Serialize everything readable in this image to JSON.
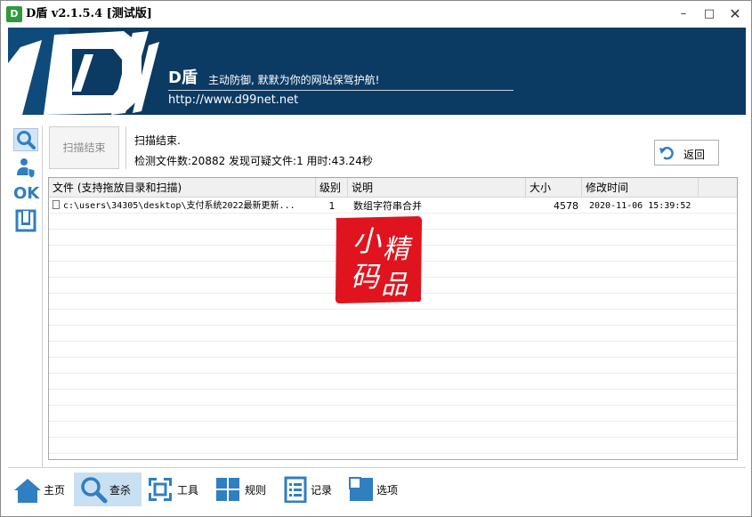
{
  "window": {
    "title": "D盾 v2.1.5.4 [测试版]",
    "icon_letter": "D",
    "controls": {
      "minimize": "–",
      "maximize": "□",
      "close": "✕"
    }
  },
  "banner": {
    "brand": "D盾",
    "slogan": "主动防御, 默默为你的网站保驾护航!",
    "url": "http://www.d99net.net",
    "background_color": "#0b3a63"
  },
  "sidebar": {
    "items": [
      {
        "name": "search",
        "icon": "search-icon",
        "active": true
      },
      {
        "name": "user-shield",
        "icon": "user-shield-icon",
        "active": false
      },
      {
        "name": "ok",
        "label": "OK",
        "active": false
      },
      {
        "name": "box",
        "icon": "box-icon",
        "active": false
      }
    ]
  },
  "scan": {
    "button_label": "扫描结束",
    "status": "扫描结束.",
    "summary": "检测文件数:20882 发现可疑文件:1 用时:43.24秒",
    "back_label": "返回"
  },
  "table": {
    "columns": [
      "文件 (支持拖放目录和扫描)",
      "级别",
      "说明",
      "大小",
      "修改时间"
    ],
    "rows": [
      {
        "file": "c:\\users\\34305\\desktop\\支付系统2022最新更新...",
        "level": "1",
        "description": "数组字符串合并",
        "size": "4578",
        "mtime": "2020-11-06 15:39:52"
      }
    ]
  },
  "watermark": {
    "chars": [
      "小",
      "精",
      "码",
      "品"
    ],
    "color": "#e0141e"
  },
  "bottom_nav": {
    "items": [
      {
        "key": "home",
        "label": "主页",
        "icon": "home-icon",
        "active": false
      },
      {
        "key": "scan",
        "label": "查杀",
        "icon": "magnifier-icon",
        "active": true
      },
      {
        "key": "tools",
        "label": "工具",
        "icon": "tools-icon",
        "active": false
      },
      {
        "key": "rules",
        "label": "规则",
        "icon": "grid-icon",
        "active": false
      },
      {
        "key": "logs",
        "label": "记录",
        "icon": "list-icon",
        "active": false
      },
      {
        "key": "options",
        "label": "选项",
        "icon": "options-icon",
        "active": false
      }
    ],
    "accent_color": "#2f7fc1"
  }
}
